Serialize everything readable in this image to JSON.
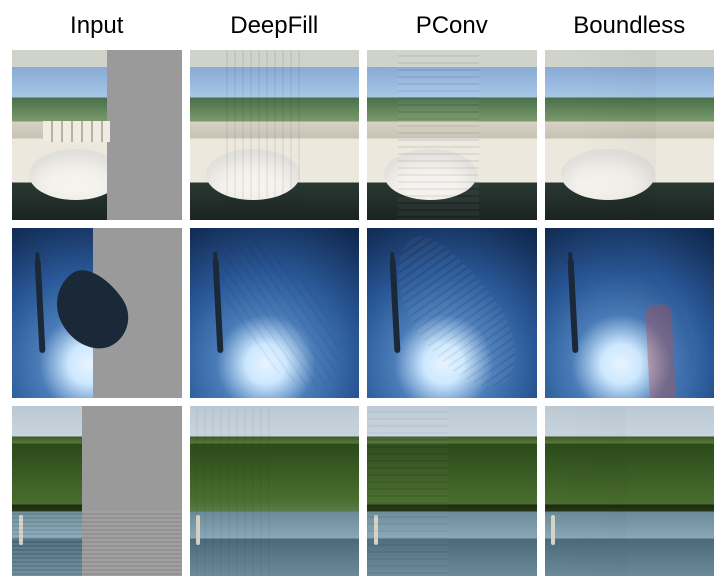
{
  "figure": {
    "columns": [
      {
        "label": "Input"
      },
      {
        "label": "DeepFill"
      },
      {
        "label": "PConv"
      },
      {
        "label": "Boundless"
      }
    ],
    "rows": [
      {
        "scene": "bathroom",
        "input_mask_class": "mask-r1"
      },
      {
        "scene": "underwater",
        "input_mask_class": "mask-r2"
      },
      {
        "scene": "river",
        "input_mask_class": "mask-r3"
      }
    ]
  }
}
